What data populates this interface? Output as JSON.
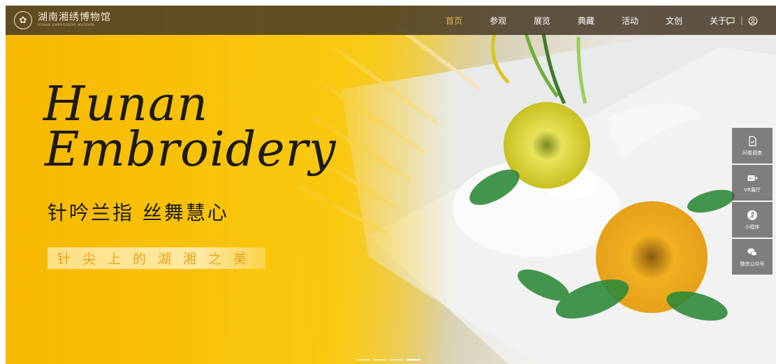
{
  "brand": {
    "name_cn": "湖南湘绣博物馆",
    "name_en": "HUNAN EMBROIDERY MUSEUM"
  },
  "nav": {
    "items": [
      {
        "label": "首页",
        "active": true
      },
      {
        "label": "参观",
        "active": false
      },
      {
        "label": "展览",
        "active": false
      },
      {
        "label": "典藏",
        "active": false
      },
      {
        "label": "活动",
        "active": false
      },
      {
        "label": "文创",
        "active": false
      },
      {
        "label": "关于",
        "active": false
      }
    ],
    "separator": "|",
    "icons": [
      "chat-icon",
      "user-icon"
    ]
  },
  "hero": {
    "title_line1": "Hunan",
    "title_line2": "Embroidery",
    "slogan": "针吟兰指 丝舞慧心",
    "ribbon": "针尖上的湖湘之美"
  },
  "float_bar": [
    {
      "label": "问卷调查",
      "icon": "survey-icon"
    },
    {
      "label": "VR展厅",
      "icon": "vr-icon"
    },
    {
      "label": "小程序",
      "icon": "miniprogram-icon"
    },
    {
      "label": "微信公众号",
      "icon": "wechat-icon"
    }
  ],
  "carousel": {
    "slides": 4,
    "active_index": 3
  },
  "colors": {
    "header_bg": "#483a28",
    "nav_active": "#d9b64b",
    "hero_yellow": "#f7b800",
    "ribbon_text": "#e5a31c"
  }
}
